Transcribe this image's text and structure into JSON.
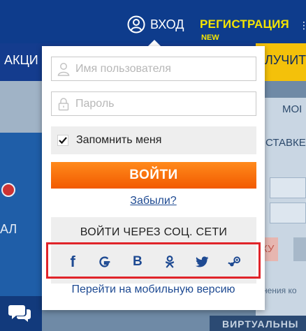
{
  "header": {
    "login_label": "ВХОД",
    "register_label": "РЕГИСТРАЦИЯ",
    "new_badge": "NEW"
  },
  "nav": {
    "left_text": "АКЦИ",
    "right_text": "ЛУЧИТ"
  },
  "background": {
    "left_text": "АЛ",
    "right_tab": "МОІ",
    "right_line": "СТАВКЕ",
    "right_button": "КУ",
    "right_small": "нения ко",
    "bottom_text": "ВИРТУАЛЬНЫ"
  },
  "login_form": {
    "username_placeholder": "Имя пользователя",
    "password_placeholder": "Пароль",
    "remember_label": "Запомнить меня",
    "remember_checked": true,
    "login_button": "ВОЙТИ",
    "forgot_link": "Забыли?",
    "social_title": "ВОЙТИ ЧЕРЕЗ СОЦ. СЕТИ",
    "social_icons": [
      "facebook-icon",
      "google-icon",
      "vkontakte-icon",
      "odnoklassniki-icon",
      "twitter-icon",
      "steam-icon"
    ],
    "vk_letter": "B",
    "facebook_letter": "f",
    "mobile_link": "Перейти на мобильную версию"
  },
  "colors": {
    "header_bg": "#0e3c8c",
    "register_yellow": "#f4e400",
    "login_orange": "#f25a00",
    "link_blue": "#1e4a92",
    "highlight_red": "#e0242a"
  }
}
